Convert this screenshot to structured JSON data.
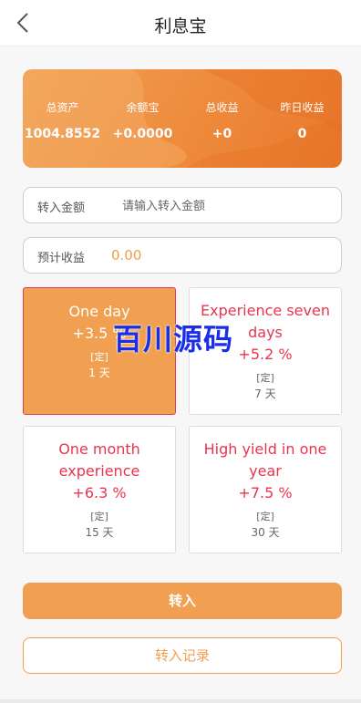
{
  "header": {
    "title": "利息宝",
    "back_icon": "chevron-left-icon"
  },
  "summary": {
    "stats": [
      {
        "label": "总资产",
        "value": "1004.8552"
      },
      {
        "label": "余额宝",
        "value": "+0.0000"
      },
      {
        "label": "总收益",
        "value": "+0"
      },
      {
        "label": "昨日收益",
        "value": "0"
      }
    ]
  },
  "transfer": {
    "label": "转入金额",
    "placeholder": "请输入转入金额",
    "value": ""
  },
  "estimate": {
    "label": "预计收益",
    "value": "0.00"
  },
  "plans": [
    {
      "name": "One day",
      "rate": "+3.5 %",
      "tag": "[定]",
      "days": "1 天",
      "selected": true
    },
    {
      "name": "Experience seven days",
      "rate": "+5.2 %",
      "tag": "[定]",
      "days": "7 天",
      "selected": false
    },
    {
      "name": "One month experience",
      "rate": "+6.3 %",
      "tag": "[定]",
      "days": "15 天",
      "selected": false
    },
    {
      "name": "High yield in one year",
      "rate": "+7.5 %",
      "tag": "[定]",
      "days": "30 天",
      "selected": false
    }
  ],
  "actions": {
    "transfer_in": "转入",
    "transfer_record": "转入记录"
  },
  "watermark": "百川源码",
  "colors": {
    "accent": "#f0a050",
    "banner": "#ee8a3c",
    "rate_red": "#e8354f",
    "watermark_blue": "#1a2ee6"
  }
}
